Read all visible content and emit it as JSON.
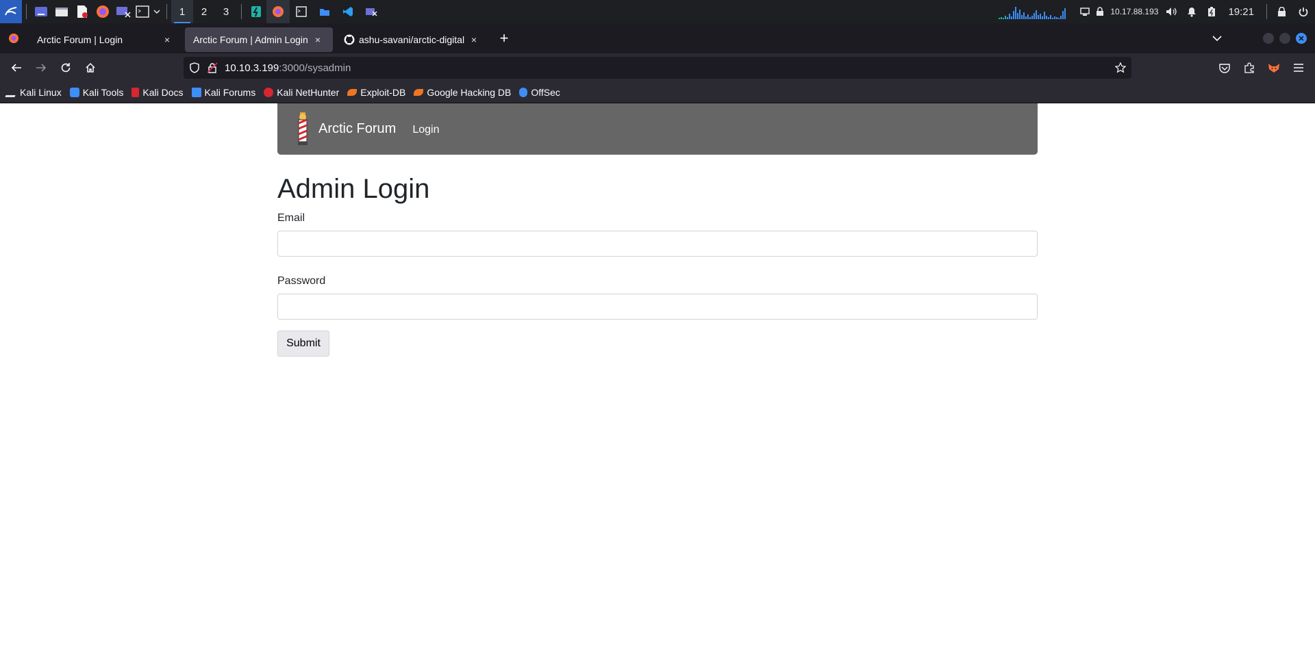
{
  "panel": {
    "workspaces": [
      "1",
      "2",
      "3"
    ],
    "ip": "10.17.88.193",
    "time": "19:21"
  },
  "tabs": [
    {
      "title": "Arctic Forum | Login",
      "close": "×"
    },
    {
      "title": "Arctic Forum | Admin Login",
      "close": "×"
    },
    {
      "title": "ashu-savani/arctic-digital",
      "close": "×"
    }
  ],
  "new_tab": "+",
  "url": {
    "host": "10.10.3.199",
    "path": ":3000/sysadmin"
  },
  "bookmarks": [
    {
      "label": "Kali Linux",
      "color": "#e6e6e6"
    },
    {
      "label": "Kali Tools",
      "color": "#3e8ef7"
    },
    {
      "label": "Kali Docs",
      "color": "#d7262f"
    },
    {
      "label": "Kali Forums",
      "color": "#3e8ef7"
    },
    {
      "label": "Kali NetHunter",
      "color": "#d7262f"
    },
    {
      "label": "Exploit-DB",
      "color": "#ee7623"
    },
    {
      "label": "Google Hacking DB",
      "color": "#ee7623"
    },
    {
      "label": "OffSec",
      "color": "#3e8ef7"
    }
  ],
  "site": {
    "brand": "Arctic Forum",
    "nav_login": "Login",
    "heading": "Admin Login",
    "email_label": "Email",
    "email_value": "",
    "password_label": "Password",
    "password_value": "",
    "submit": "Submit"
  },
  "colors": {
    "panel_accent": "#3e8ef7",
    "site_nav": "#666666"
  }
}
